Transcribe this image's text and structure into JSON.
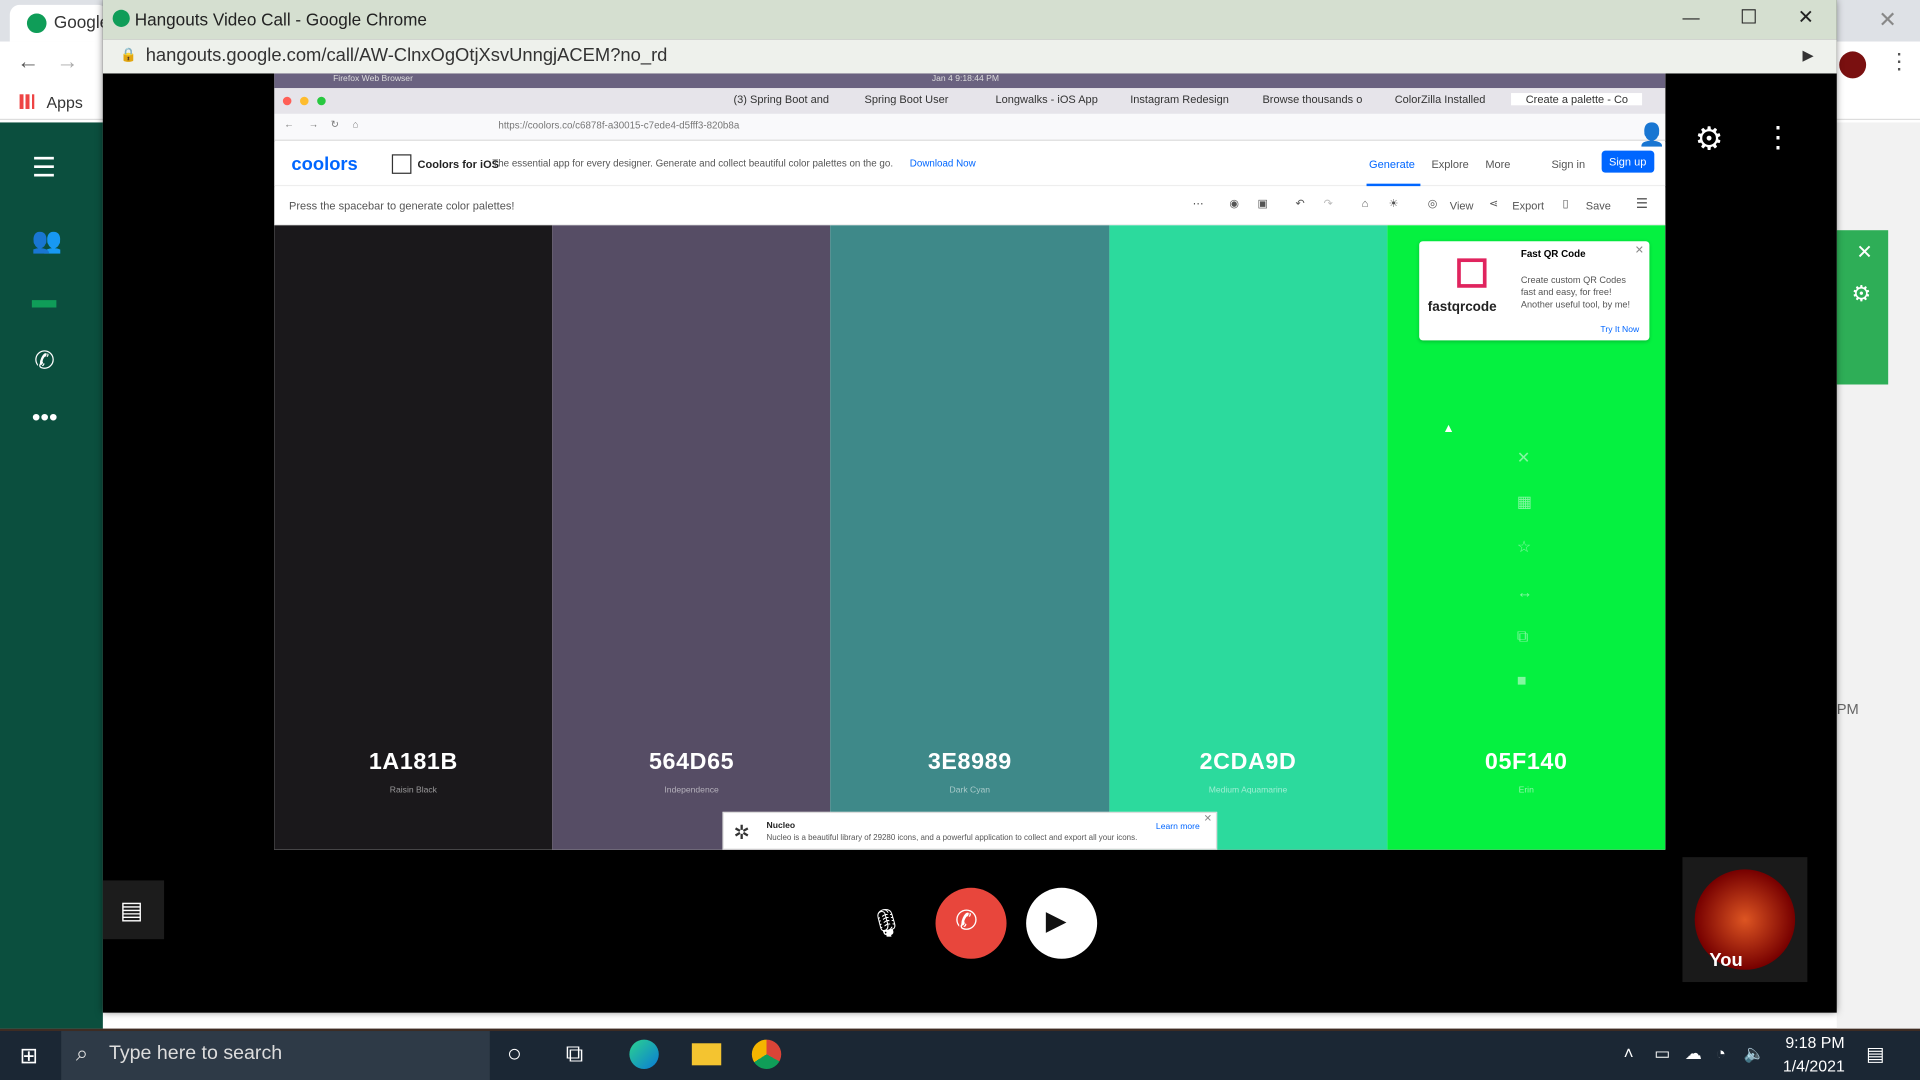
{
  "background_window": {
    "tab_title": "Google",
    "bookmarks_apps": "Apps",
    "time_label_right": "PM"
  },
  "window": {
    "title": "Hangouts Video Call - Google Chrome",
    "url": "hangouts.google.com/call/AW-ClnxOgOtjXsvUnngjACEM?no_rd"
  },
  "shared_screen": {
    "firefox_title": "Firefox Web Browser",
    "clock": "Jan 4  9:18:44 PM",
    "tabs": [
      "(3) Spring Boot and",
      "Spring Boot User",
      "Longwalks - iOS App",
      "Instagram Redesign",
      "Browse thousands o",
      "ColorZilla Installed",
      "Create a palette - Co"
    ],
    "site_url": "https://coolors.co/c6878f-a30015-c7ede4-d5fff3-820b8a",
    "header": {
      "logo": "coolors",
      "ios_title": "Coolors for iOS",
      "ios_desc": "The essential app for every designer. Generate and collect beautiful color palettes on the go.",
      "download": "Download Now",
      "nav_generate": "Generate",
      "nav_explore": "Explore",
      "nav_more": "More",
      "sign_in": "Sign in",
      "sign_up": "Sign up"
    },
    "toolbar": {
      "hint": "Press the spacebar to generate color palettes!",
      "view": "View",
      "export": "Export",
      "save": "Save"
    },
    "palette": [
      {
        "hex": "1A181B",
        "name": "Raisin Black",
        "color": "#1a181b"
      },
      {
        "hex": "564D65",
        "name": "Independence",
        "color": "#564d65"
      },
      {
        "hex": "3E8989",
        "name": "Dark Cyan",
        "color": "#3e8989"
      },
      {
        "hex": "2CDA9D",
        "name": "Medium Aquamarine",
        "color": "#2cda9d"
      },
      {
        "hex": "05F140",
        "name": "Erin",
        "color": "#05f140"
      }
    ],
    "ad": {
      "title": "Fast QR Code",
      "brand": "fastqrcode",
      "desc": "Create custom QR Codes fast and easy, for free! Another useful tool, by me!",
      "cta": "Try It Now"
    },
    "nucleo": {
      "title": "Nucleo",
      "desc": "Nucleo is a beautiful library of 29280 icons, and a powerful application to collect and export all your icons.",
      "learn": "Learn more"
    }
  },
  "call": {
    "self_label": "You"
  },
  "taskbar": {
    "search_placeholder": "Type here to search",
    "time": "9:18 PM",
    "date": "1/4/2021"
  }
}
